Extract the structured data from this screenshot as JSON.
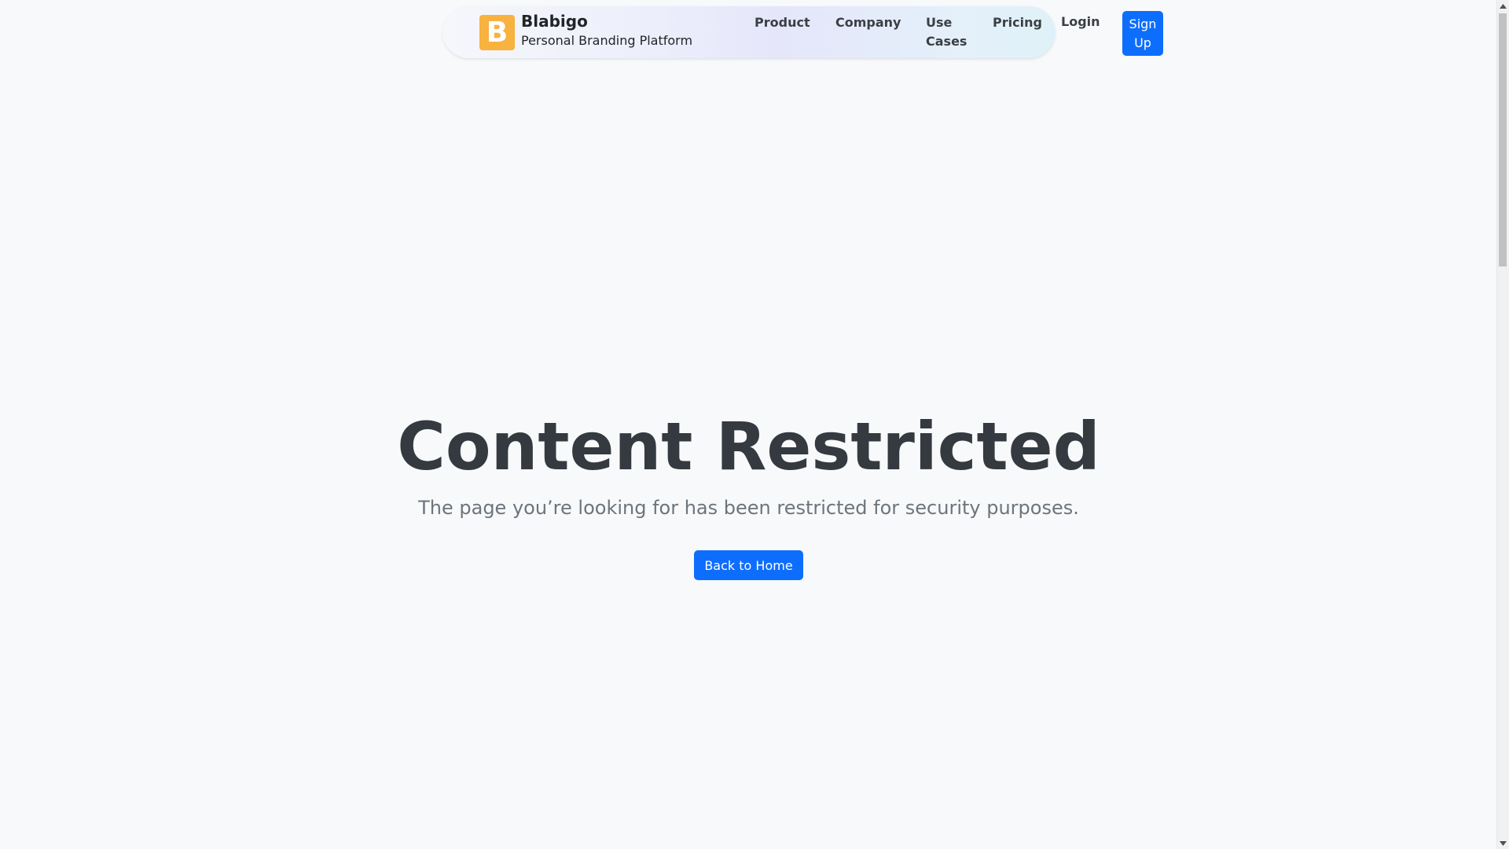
{
  "header": {
    "brand": {
      "logo_letter": "B",
      "name": "Blabigo",
      "tagline": "Personal Branding Platform"
    },
    "nav": {
      "product": "Product",
      "company": "Company",
      "use_cases": "Use Cases",
      "pricing": "Pricing"
    },
    "login": "Login",
    "signup": "Sign Up"
  },
  "main": {
    "title": "Content Restricted",
    "message": "The page you’re looking for has been restricted for security purposes.",
    "back_button": "Back to Home"
  },
  "colors": {
    "primary": "#0d6efd",
    "logo": "#f7b23f",
    "title": "#343a40",
    "muted": "#6c757d",
    "background": "#f8f9fa"
  }
}
